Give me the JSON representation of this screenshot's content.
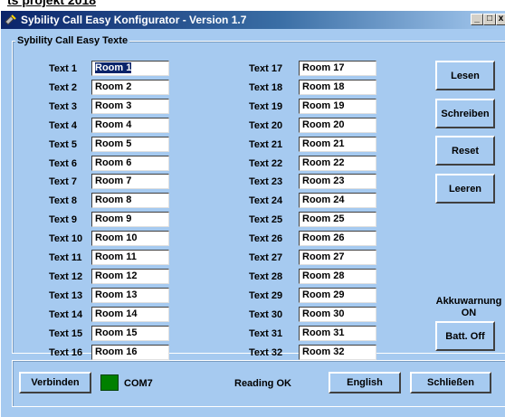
{
  "top_fragment": "ts projekt 2018",
  "window": {
    "title": "Sybility Call Easy Konfigurator - Version 1.7",
    "buttons": {
      "minimize": "_",
      "maximize": "□",
      "close": "x"
    }
  },
  "group": {
    "label": "Sybility Call Easy Texte",
    "labels": [
      "Text 1",
      "Text 2",
      "Text 3",
      "Text 4",
      "Text 5",
      "Text 6",
      "Text 7",
      "Text 8",
      "Text 9",
      "Text 10",
      "Text 11",
      "Text 12",
      "Text 13",
      "Text 14",
      "Text 15",
      "Text 16",
      "Text 17",
      "Text 18",
      "Text 19",
      "Text 20",
      "Text 21",
      "Text 22",
      "Text 23",
      "Text 24",
      "Text 25",
      "Text 26",
      "Text 27",
      "Text 28",
      "Text 29",
      "Text 30",
      "Text 31",
      "Text 32"
    ],
    "values": [
      "Room 1",
      "Room 2",
      "Room 3",
      "Room 4",
      "Room 5",
      "Room 6",
      "Room 7",
      "Room 8",
      "Room 9",
      "Room 10",
      "Room 11",
      "Room 12",
      "Room 13",
      "Room 14",
      "Room 15",
      "Room 16",
      "Room 17",
      "Room 18",
      "Room 19",
      "Room 20",
      "Room 21",
      "Room 22",
      "Room 23",
      "Room 24",
      "Room 25",
      "Room 26",
      "Room 27",
      "Room 28",
      "Room 29",
      "Room 30",
      "Room 31",
      "Room 32"
    ]
  },
  "actions": {
    "lesen": "Lesen",
    "schreiben": "Schreiben",
    "reset": "Reset",
    "leeren": "Leeren",
    "akku_label": "Akkuwarnung",
    "akku_state": "ON",
    "batt_off": "Batt. Off"
  },
  "status": {
    "connect": "Verbinden",
    "led_color": "#008000",
    "port": "COM7",
    "message": "Reading OK",
    "language": "English",
    "close": "Schließen"
  }
}
